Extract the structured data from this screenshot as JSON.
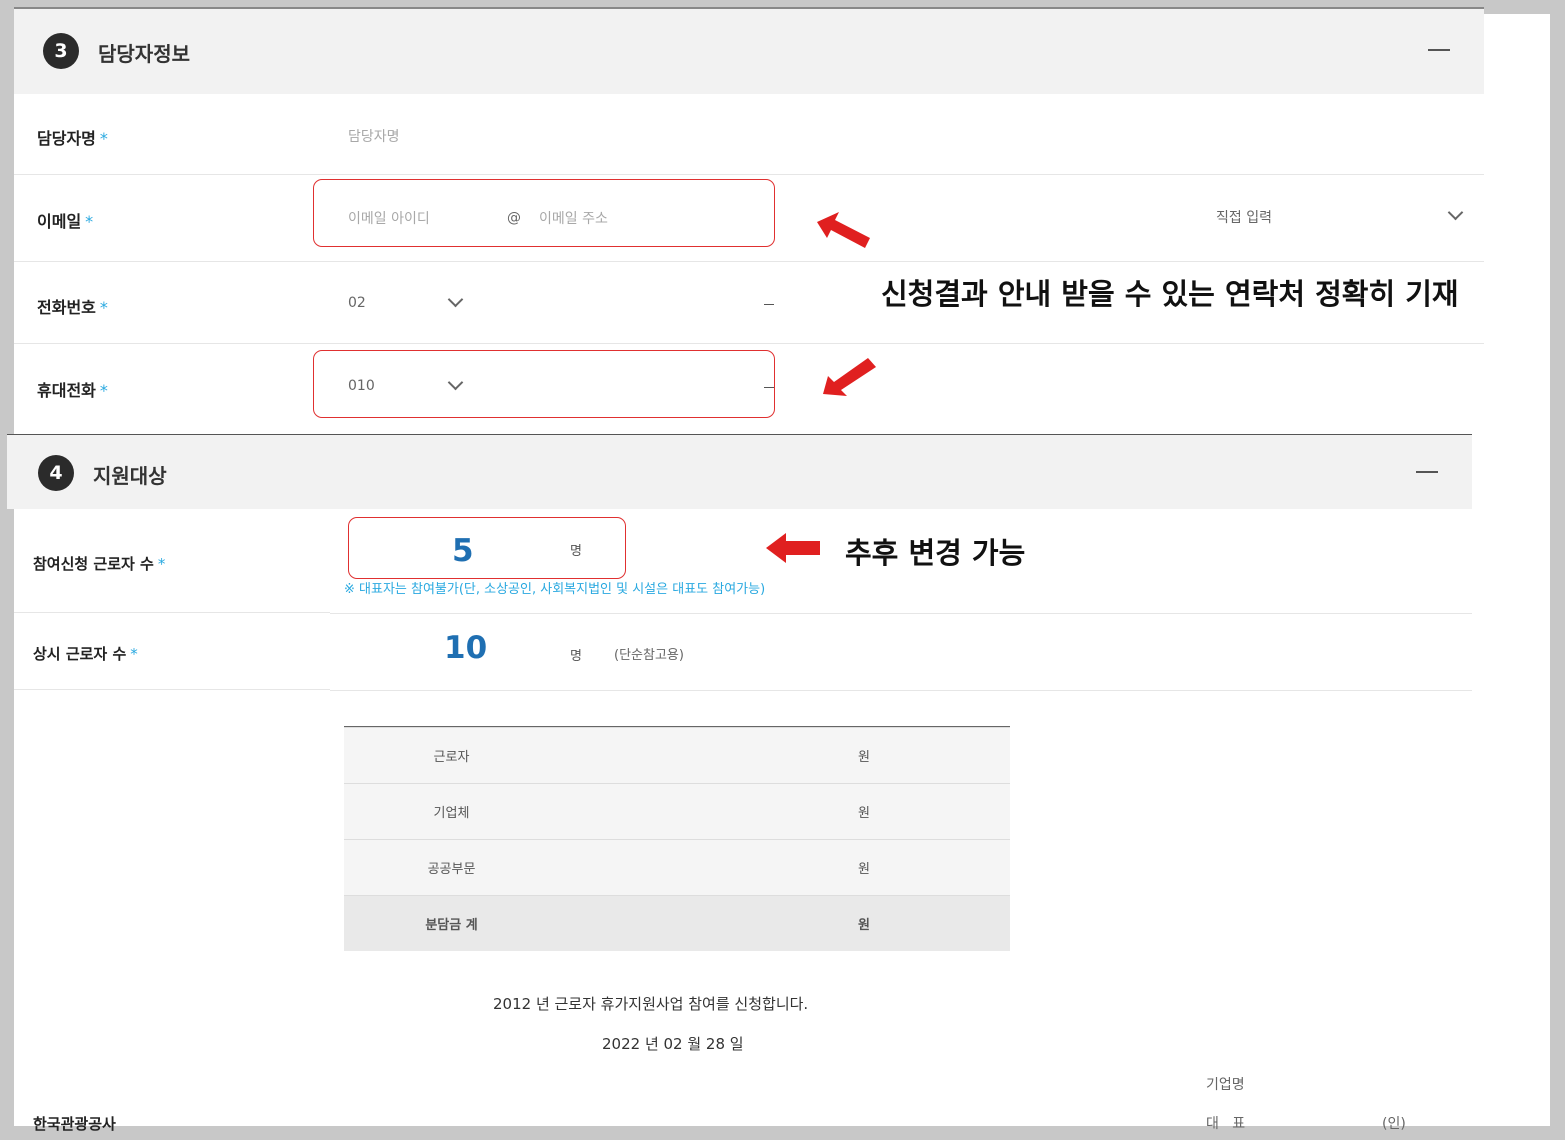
{
  "section3": {
    "num": "3",
    "title": "담당자정보",
    "fields": {
      "manager_name": {
        "label": "담당자명",
        "placeholder": "담당자명"
      },
      "email": {
        "label": "이메일",
        "id_placeholder": "이메일 아이디",
        "at": "@",
        "domain_placeholder": "이메일 주소",
        "select_value": "직접 입력"
      },
      "phone": {
        "label": "전화번호",
        "area_code": "02",
        "separator": "–"
      },
      "mobile": {
        "label": "휴대전화",
        "prefix": "010",
        "separator": "–"
      }
    },
    "required_mark": "*"
  },
  "section4": {
    "num": "4",
    "title": "지원대상",
    "participants": {
      "label": "참여신청 근로자 수",
      "value": "5",
      "unit": "명",
      "note": "※ 대표자는 참여불가(단, 소상공인, 사회복지법인 및 시설은 대표도 참여가능)"
    },
    "regular_workers": {
      "label": "상시 근로자 수",
      "value": "10",
      "unit": "명",
      "note": "(단순참고용)"
    },
    "cost_table": [
      {
        "item": "근로자",
        "unit": "원"
      },
      {
        "item": "기업체",
        "unit": "원"
      },
      {
        "item": "공공부문",
        "unit": "원"
      },
      {
        "item": "분담금 계",
        "unit": "원"
      }
    ]
  },
  "declaration": "2012 년 근로자 휴가지원사업 참여를 신청합니다.",
  "date": "2022 년 02 월 28 일",
  "footer": {
    "org": "한국관광공사",
    "company_label": "기업명",
    "rep_label": "대   표",
    "seal": "(인)"
  },
  "annotations": {
    "contact_note": "신청결과 안내 받을 수 있는 연락처 정확히 기재",
    "change_note": "추후 변경 가능"
  },
  "colors": {
    "accent_blue": "#2aa9e0",
    "value_blue": "#1f6fb2",
    "highlight_red": "#e03030"
  },
  "icons": [
    "minus-icon",
    "chevron-down-icon",
    "red-arrow-icon"
  ]
}
